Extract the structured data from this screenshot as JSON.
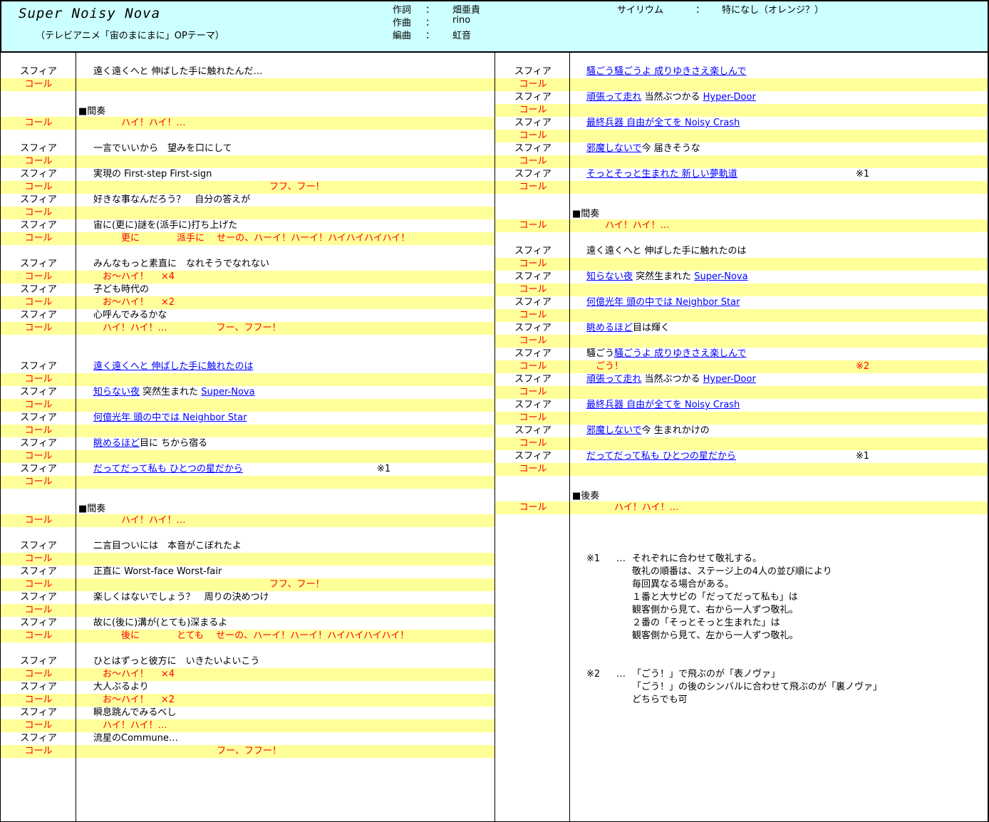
{
  "header": {
    "title": "Super Noisy Nova",
    "subtitle": "（テレビアニメ「宙のまにまに」OPテーマ）",
    "credits": [
      {
        "label": "作詞",
        "sep": "：",
        "value": "畑亜貴"
      },
      {
        "label": "作曲",
        "sep": "：",
        "value": "rino"
      },
      {
        "label": "編曲",
        "sep": "：",
        "value": "虹音"
      }
    ],
    "psyllium": {
      "label": "サイリウム",
      "sep": "：",
      "value": "特になし（オレンジ？）"
    }
  },
  "colors": {
    "call_bg": "#ffff99",
    "header_bg": "#ccffff",
    "call_text": "#ff0000",
    "link": "#0000ff"
  },
  "left_rows": [
    {
      "who": "スフィア",
      "parts": [
        {
          "t": "遠く遠くへと 伸ばした手に触れたんだ…"
        }
      ]
    },
    {
      "who": "コール",
      "call": true,
      "parts": []
    },
    {},
    {
      "section": "■間奏"
    },
    {
      "who": "コール",
      "call": true,
      "parts": [
        {
          "t": "　　　ハイ！ハイ！…"
        }
      ]
    },
    {},
    {
      "who": "スフィア",
      "parts": [
        {
          "t": "一言でいいから　望みを口にして"
        }
      ]
    },
    {
      "who": "コール",
      "call": true,
      "parts": []
    },
    {
      "who": "スフィア",
      "parts": [
        {
          "t": "実現の First-step First-sign"
        }
      ]
    },
    {
      "who": "コール",
      "call": true,
      "parts": [
        {
          "t": "　　　　　　　　　　　　　　　　　　　フフ、フー！"
        }
      ]
    },
    {
      "who": "スフィア",
      "parts": [
        {
          "t": "好きな事なんだろう？　自分の答えが"
        }
      ]
    },
    {
      "who": "コール",
      "call": true,
      "parts": []
    },
    {
      "who": "スフィア",
      "parts": [
        {
          "t": "宙に(更に)謎を(派手に)打ち上げた"
        }
      ]
    },
    {
      "who": "コール",
      "call": true,
      "parts": [
        {
          "t": "　　　更に　　　　派手に　 せーの、ハーイ！ハーイ！ハイハイハイハイ！"
        }
      ]
    },
    {},
    {
      "who": "スフィア",
      "parts": [
        {
          "t": "みんなもっと素直に　なれそうでなれない"
        }
      ]
    },
    {
      "who": "コール",
      "call": true,
      "parts": [
        {
          "t": "　お～ハイ！　 ×4"
        }
      ]
    },
    {
      "who": "スフィア",
      "parts": [
        {
          "t": "子ども時代の"
        }
      ]
    },
    {
      "who": "コール",
      "call": true,
      "parts": [
        {
          "t": "　お～ハイ！　 ×2"
        }
      ]
    },
    {
      "who": "スフィア",
      "parts": [
        {
          "t": "心呼んでみるかな"
        }
      ]
    },
    {
      "who": "コール",
      "call": true,
      "parts": [
        {
          "t": "　ハイ！ハイ！…　　　　　 フー、フフー！"
        }
      ]
    },
    {},
    {},
    {
      "who": "スフィア",
      "parts": [
        {
          "t": "遠く遠くへと 伸ばした手に触れたのは",
          "link": true
        }
      ]
    },
    {
      "who": "コール",
      "call": true,
      "parts": []
    },
    {
      "who": "スフィア",
      "parts": [
        {
          "t": "知らない夜",
          "link": true
        },
        {
          "t": " 突然生まれた "
        },
        {
          "t": "Super-Nova",
          "link": true
        }
      ]
    },
    {
      "who": "コール",
      "call": true,
      "parts": []
    },
    {
      "who": "スフィア",
      "parts": [
        {
          "t": "何億光年 頭の中では Neighbor Star",
          "link": true
        }
      ]
    },
    {
      "who": "コール",
      "call": true,
      "parts": []
    },
    {
      "who": "スフィア",
      "parts": [
        {
          "t": "眺めるほど",
          "link": true
        },
        {
          "t": "目に ちから宿る"
        }
      ]
    },
    {
      "who": "コール",
      "call": true,
      "parts": []
    },
    {
      "who": "スフィア",
      "parts": [
        {
          "t": "だってだって私も ひとつの星だから",
          "link": true
        }
      ],
      "note": "※1"
    },
    {
      "who": "コール",
      "call": true,
      "parts": []
    },
    {},
    {
      "section": "■間奏"
    },
    {
      "who": "コール",
      "call": true,
      "parts": [
        {
          "t": "　　　ハイ！ハイ！…"
        }
      ]
    },
    {},
    {
      "who": "スフィア",
      "parts": [
        {
          "t": "二言目ついには　本音がこぼれたよ"
        }
      ]
    },
    {
      "who": "コール",
      "call": true,
      "parts": []
    },
    {
      "who": "スフィア",
      "parts": [
        {
          "t": "正直に Worst-face Worst-fair"
        }
      ]
    },
    {
      "who": "コール",
      "call": true,
      "parts": [
        {
          "t": "　　　　　　　　　　　　　　　　　　　フフ、フー！"
        }
      ]
    },
    {
      "who": "スフィア",
      "parts": [
        {
          "t": "楽しくはないでしょう？　周りの決めつけ"
        }
      ]
    },
    {
      "who": "コール",
      "call": true,
      "parts": []
    },
    {
      "who": "スフィア",
      "parts": [
        {
          "t": "故に(後に)溝が(とても)深まるよ"
        }
      ]
    },
    {
      "who": "コール",
      "call": true,
      "parts": [
        {
          "t": "　　　後に　　　　とても　 せーの、ハーイ！ハーイ！ハイハイハイハイ！"
        }
      ]
    },
    {},
    {
      "who": "スフィア",
      "parts": [
        {
          "t": "ひとはずっと彼方に　いきたいよいこう"
        }
      ]
    },
    {
      "who": "コール",
      "call": true,
      "parts": [
        {
          "t": "　お～ハイ！　 ×4"
        }
      ]
    },
    {
      "who": "スフィア",
      "parts": [
        {
          "t": "大人ぶるより"
        }
      ]
    },
    {
      "who": "コール",
      "call": true,
      "parts": [
        {
          "t": "　お～ハイ！　 ×2"
        }
      ]
    },
    {
      "who": "スフィア",
      "parts": [
        {
          "t": "瞬息跳んでみるべし"
        }
      ]
    },
    {
      "who": "コール",
      "call": true,
      "parts": [
        {
          "t": "　ハイ！ハイ！…"
        }
      ]
    },
    {
      "who": "スフィア",
      "parts": [
        {
          "t": "流星のCommune…"
        }
      ]
    },
    {
      "who": "コール",
      "call": true,
      "parts": [
        {
          "t": "　　　　　　　　　　　　　 フー、フフー！"
        }
      ]
    }
  ],
  "right_rows": [
    {
      "who": "スフィア",
      "parts": [
        {
          "t": "騒ごう騒ごうよ 成りゆきさえ楽しんで",
          "link": true
        }
      ]
    },
    {
      "who": "コール",
      "call": true,
      "parts": []
    },
    {
      "who": "スフィア",
      "parts": [
        {
          "t": "頑張って走れ",
          "link": true
        },
        {
          "t": " 当然ぶつかる "
        },
        {
          "t": "Hyper-Door",
          "link": true
        }
      ]
    },
    {
      "who": "コール",
      "call": true,
      "parts": []
    },
    {
      "who": "スフィア",
      "parts": [
        {
          "t": "最終兵器 自由が全てを Noisy Crash",
          "link": true
        }
      ]
    },
    {
      "who": "コール",
      "call": true,
      "parts": []
    },
    {
      "who": "スフィア",
      "parts": [
        {
          "t": "邪魔しないで",
          "link": true
        },
        {
          "t": "今 届きそうな"
        }
      ]
    },
    {
      "who": "コール",
      "call": true,
      "parts": []
    },
    {
      "who": "スフィア",
      "parts": [
        {
          "t": "そっとそっと生まれた 新しい夢軌道",
          "link": true
        }
      ],
      "note": "※1"
    },
    {
      "who": "コール",
      "call": true,
      "parts": []
    },
    {},
    {
      "section": "■間奏"
    },
    {
      "who": "コール",
      "call": true,
      "parts": [
        {
          "t": "　　ハイ！ハイ！…"
        }
      ]
    },
    {},
    {
      "who": "スフィア",
      "parts": [
        {
          "t": "遠く遠くへと 伸ばした手に触れたのは"
        }
      ]
    },
    {
      "who": "コール",
      "call": true,
      "parts": []
    },
    {
      "who": "スフィア",
      "parts": [
        {
          "t": "知らない夜",
          "link": true
        },
        {
          "t": " 突然生まれた "
        },
        {
          "t": "Super-Nova",
          "link": true
        }
      ]
    },
    {
      "who": "コール",
      "call": true,
      "parts": []
    },
    {
      "who": "スフィア",
      "parts": [
        {
          "t": "何億光年 頭の中では Neighbor Star",
          "link": true
        }
      ]
    },
    {
      "who": "コール",
      "call": true,
      "parts": []
    },
    {
      "who": "スフィア",
      "parts": [
        {
          "t": "眺めるほど",
          "link": true
        },
        {
          "t": "目は輝く"
        }
      ]
    },
    {
      "who": "コール",
      "call": true,
      "parts": []
    },
    {
      "who": "スフィア",
      "parts": [
        {
          "t": "騒ごう"
        },
        {
          "t": "騒ごうよ 成りゆきさえ楽しんで",
          "link": true
        }
      ]
    },
    {
      "who": "コール",
      "call": true,
      "parts": [
        {
          "t": "　ごう！"
        }
      ],
      "note": "※2"
    },
    {
      "who": "スフィア",
      "parts": [
        {
          "t": "頑張って走れ",
          "link": true
        },
        {
          "t": " 当然ぶつかる "
        },
        {
          "t": "Hyper-Door",
          "link": true
        }
      ]
    },
    {
      "who": "コール",
      "call": true,
      "parts": []
    },
    {
      "who": "スフィア",
      "parts": [
        {
          "t": "最終兵器 自由が全てを Noisy Crash",
          "link": true
        }
      ]
    },
    {
      "who": "コール",
      "call": true,
      "parts": []
    },
    {
      "who": "スフィア",
      "parts": [
        {
          "t": "邪魔しないで",
          "link": true
        },
        {
          "t": "今 生まれかけの"
        }
      ]
    },
    {
      "who": "コール",
      "call": true,
      "parts": []
    },
    {
      "who": "スフィア",
      "parts": [
        {
          "t": "だってだって私も ひとつの星だから",
          "link": true
        }
      ],
      "note": "※1"
    },
    {
      "who": "コール",
      "call": true,
      "parts": []
    },
    {},
    {
      "section": "■後奏"
    },
    {
      "who": "コール",
      "call": true,
      "parts": [
        {
          "t": "　　　ハイ！ハイ！…"
        }
      ]
    }
  ],
  "notes": [
    {
      "mark": "※1",
      "dots": "…",
      "lines": [
        "それぞれに合わせて敬礼する。",
        "敬礼の順番は、ステージ上の4人の並び順により",
        "毎回異なる場合がある。",
        "１番と大サビの「だってだって私も」は",
        "観客側から見て、右から一人ずつ敬礼。",
        "２番の「そっとそっと生まれた」は",
        "観客側から見て、左から一人ずつ敬礼。"
      ]
    },
    {
      "mark": "※2",
      "dots": "…",
      "lines": [
        "「ごう！」で飛ぶのが「表ノヴァ」",
        "「ごう！」の後のシンバルに合わせて飛ぶのが「裏ノヴァ」",
        "どちらでも可"
      ]
    }
  ]
}
